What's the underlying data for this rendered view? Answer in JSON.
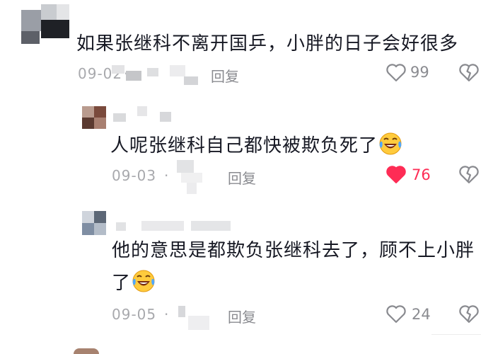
{
  "comments": [
    {
      "text": "如果张继科不离开国乒，小胖的日子会好很多",
      "date": "09-02",
      "location_fragment": "·",
      "reply_label": "回复",
      "likes": "99",
      "liked": false
    },
    {
      "text": "人呢张继科自己都快被欺负死了",
      "emoji": "laughing-tears-emoji",
      "date": "09-03",
      "location_fragment": "·",
      "reply_label": "回复",
      "likes": "76",
      "liked": true
    },
    {
      "text_line1": "他的意思是都欺负张继科去了，顾不上小胖",
      "text_line2": "了",
      "emoji": "laughing-tears-emoji",
      "date": "09-05",
      "location_fragment": "·",
      "reply_label": "回复",
      "likes": "24",
      "liked": false
    }
  ],
  "icons": {
    "like": "heart-outline-icon",
    "liked": "heart-filled-icon",
    "dislike": "broken-heart-icon"
  },
  "colors": {
    "liked": "#fe2c55",
    "text": "#161823",
    "meta": "#a8a9ad"
  }
}
